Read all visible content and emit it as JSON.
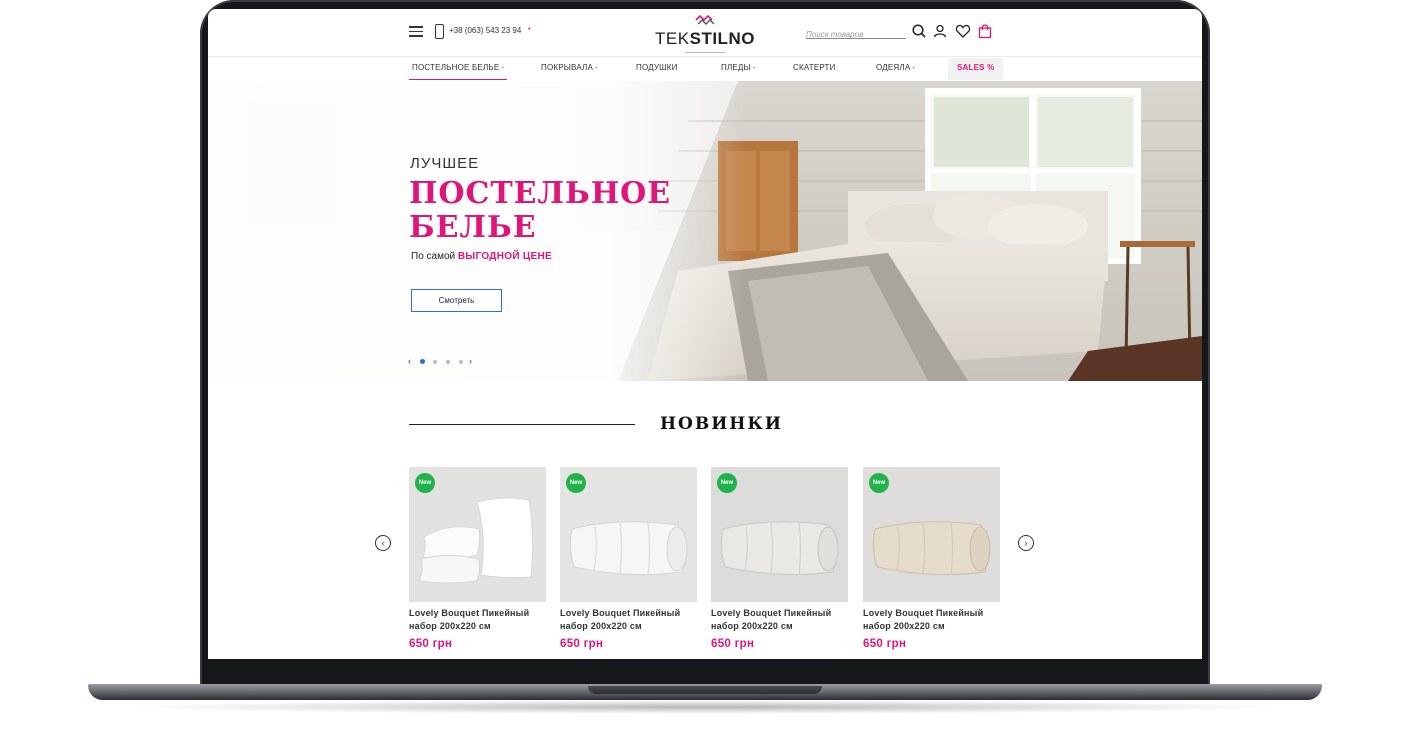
{
  "header": {
    "phone": "+38 (063) 543 23 94",
    "logo_light": "TEK",
    "logo_bold": "STILNO",
    "search_placeholder": "Поиск товаров"
  },
  "nav": {
    "items": [
      {
        "label": "ПОСТЕЛЬНОЕ БЕЛЬЕ",
        "has_dropdown": true,
        "active": true
      },
      {
        "label": "ПОКРЫВАЛА",
        "has_dropdown": true
      },
      {
        "label": "ПОДУШКИ",
        "has_dropdown": false
      },
      {
        "label": "ПЛЕДЫ",
        "has_dropdown": true
      },
      {
        "label": "СКАТЕРТИ",
        "has_dropdown": false
      },
      {
        "label": "ОДЕЯЛА",
        "has_dropdown": true
      },
      {
        "label": "SALES %",
        "has_dropdown": false
      }
    ],
    "dropdown_glyph": "•"
  },
  "hero": {
    "pretitle": "ЛУЧШЕЕ",
    "title": "ПОСТЕЛЬНОЕ\nБЕЛЬЕ",
    "subtitle_prefix": "По самой",
    "subtitle_accent": "ВЫГОДНОЙ ЦЕНЕ",
    "button_label": "Смотреть",
    "slides_total": 4,
    "active_slide": 1,
    "prev_glyph": "‹",
    "next_glyph": "›"
  },
  "section": {
    "title": "НОВИНКИ",
    "prev_glyph": "‹",
    "next_glyph": "›"
  },
  "products": [
    {
      "badge": "New",
      "name": "Lovely Bouquet Пикейный набор 200x220 см",
      "price": "650 грн",
      "image": "pillows-icon"
    },
    {
      "badge": "New",
      "name": "Lovely Bouquet Пикейный набор 200x220 см",
      "price": "650 грн",
      "image": "white-blanket-icon"
    },
    {
      "badge": "New",
      "name": "Lovely Bouquet Пикейный набор 200x220 см",
      "price": "650 грн",
      "image": "grey-blanket-icon"
    },
    {
      "badge": "New",
      "name": "Lovely Bouquet Пикейный набор 200x220 см",
      "price": "650 грн",
      "image": "beige-blanket-icon"
    }
  ],
  "colors": {
    "accent": "#e0157a",
    "badge": "#22b24c",
    "button_border": "#2c6ed5"
  }
}
